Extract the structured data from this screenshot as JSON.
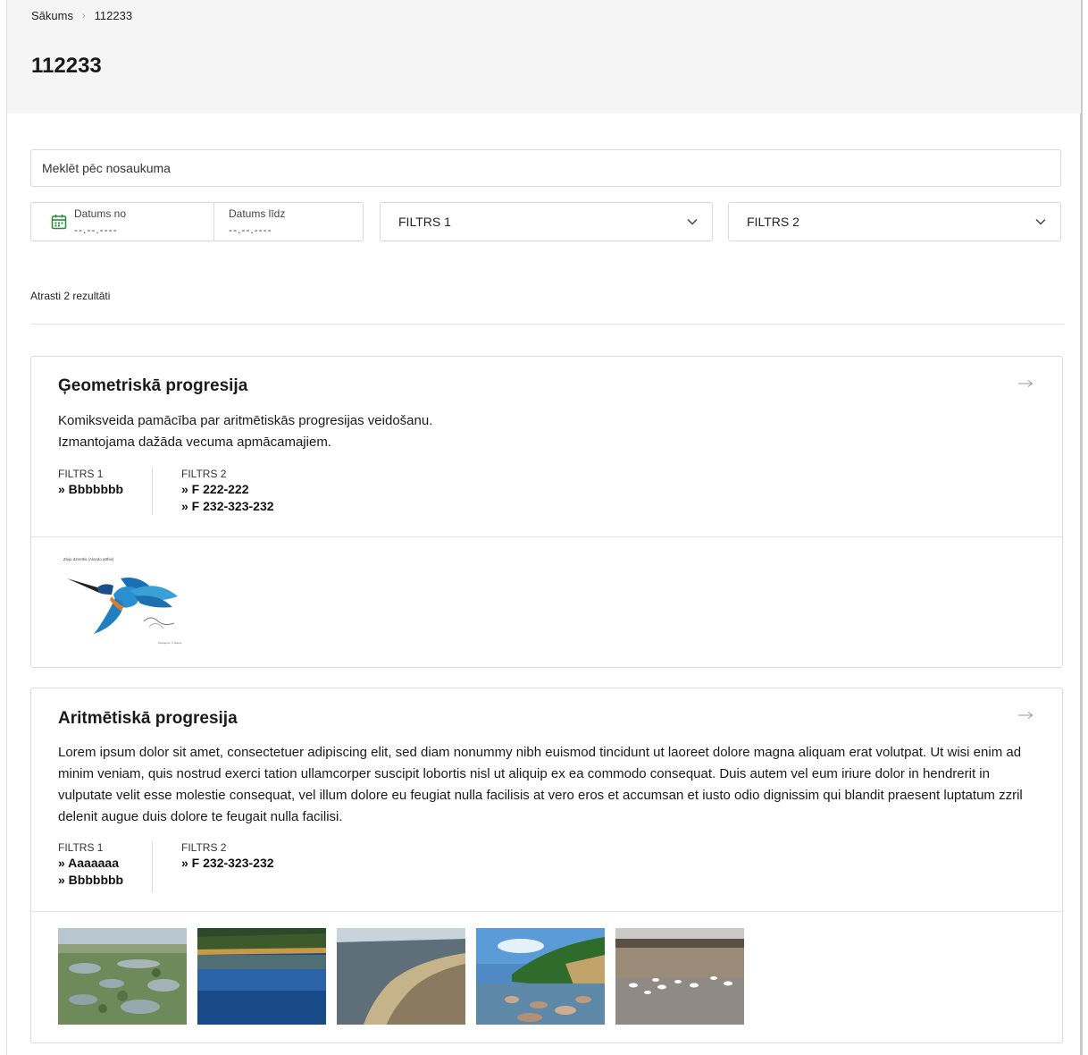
{
  "breadcrumb": {
    "home": "Sākums",
    "separator": "›",
    "current": "112233"
  },
  "page": {
    "title": "112233"
  },
  "search": {
    "placeholder": "Meklēt pēc nosaukuma"
  },
  "date_filter": {
    "from_label": "Datums no",
    "from_value": "--.--.----",
    "to_label": "Datums līdz",
    "to_value": "--.--.----",
    "icon": "calendar-icon"
  },
  "filters": {
    "filter1": "FILTRS 1",
    "filter2": "FILTRS 2"
  },
  "results": {
    "count_text": "Atrasti 2 rezultāti"
  },
  "cards": [
    {
      "title": "Ģeometriskā progresija",
      "description": [
        "Komiksveida pamācība par aritmētiskās progresijas veidošanu.",
        "Izmantojama dažāda vecuma apmācamajiem."
      ],
      "filter1_label": "FILTRS 1",
      "filter1_values": [
        "» Bbbbbbb"
      ],
      "filter2_label": "FILTRS 2",
      "filter2_values": [
        "» F 222-222",
        "» F 232-323-232"
      ],
      "image_caption": "Zivju dzenītis (Alcedo atthis)",
      "image_credit": "Zīmējums: © Autors"
    },
    {
      "title": "Aritmētiskā progresija",
      "description": [
        "Lorem ipsum dolor sit amet, consectetuer adipiscing elit, sed diam nonummy nibh euismod tincidunt ut laoreet dolore magna aliquam erat volutpat. Ut wisi enim ad minim veniam, quis nostrud exerci tation ullamcorper suscipit lobortis nisl ut aliquip ex ea commodo consequat. Duis autem vel eum iriure dolor in hendrerit in vulputate velit esse molestie consequat, vel illum dolore eu feugiat nulla facilisis at vero eros et accumsan et iusto odio dignissim qui blandit praesent luptatum zzril delenit augue duis dolore te feugait nulla facilisi."
      ],
      "filter1_label": "FILTRS 1",
      "filter1_values": [
        "» Aaaaaaa",
        "» Bbbbbbb"
      ],
      "filter2_label": "FILTRS 2",
      "filter2_values": [
        "» F 232-323-232"
      ]
    }
  ],
  "colors": {
    "accent": "#2e8b3e",
    "header_bg": "#f5f5f5",
    "border": "#dcdcdc"
  }
}
